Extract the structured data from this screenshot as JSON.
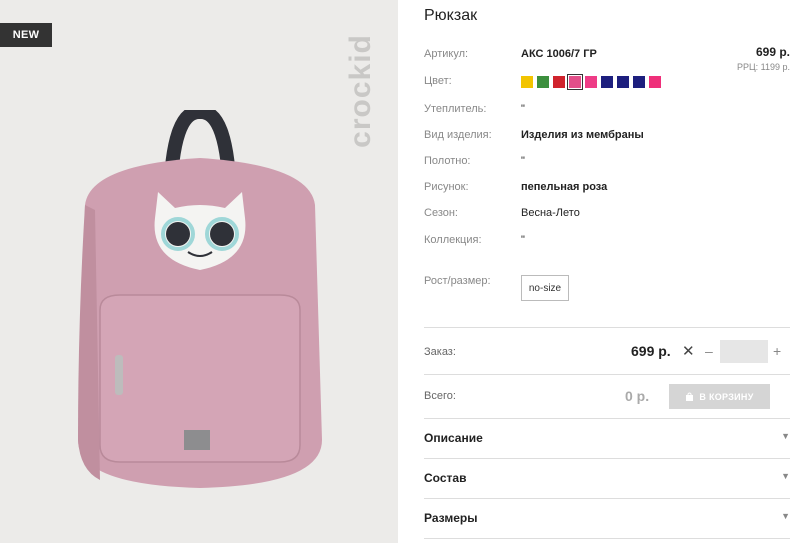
{
  "badge": {
    "label": "NEW"
  },
  "brand": {
    "logo_text": "crockid"
  },
  "product": {
    "title": "Рюкзак",
    "price": "699 р.",
    "rrp": "РРЦ: 1199 р.",
    "attributes": {
      "article_label": "Артикул:",
      "article_value": "АКС 1006/7 ГР",
      "color_label": "Цвет:",
      "insulation_label": "Утеплитель:",
      "insulation_value": "\"",
      "type_label": "Вид изделия:",
      "type_value": "Изделия из мембраны",
      "fabric_label": "Полотно:",
      "fabric_value": "\"",
      "pattern_label": "Рисунок:",
      "pattern_value": "пепельная роза",
      "season_label": "Сезон:",
      "season_value": "Весна-Лето",
      "collection_label": "Коллекция:",
      "collection_value": "\"",
      "size_label": "Рост/размер:",
      "size_value": "no-size"
    },
    "swatch_colors": [
      "#f2c400",
      "#3c8f3e",
      "#d0232d",
      "#e34f8a",
      "#ee3c86",
      "#1d1f7e",
      "#1d1f7e",
      "#1d1f7e",
      "#ef2f7a"
    ],
    "selected_swatch_index": 3
  },
  "order": {
    "label": "Заказ:",
    "price": "699 р.",
    "times": "✕",
    "minus": "–",
    "plus": "+",
    "quantity": ""
  },
  "total": {
    "label": "Всего:",
    "value": "0 р.",
    "cart_button": "В КОРЗИНУ"
  },
  "accordions": [
    {
      "title": "Описание"
    },
    {
      "title": "Состав"
    },
    {
      "title": "Размеры"
    }
  ]
}
